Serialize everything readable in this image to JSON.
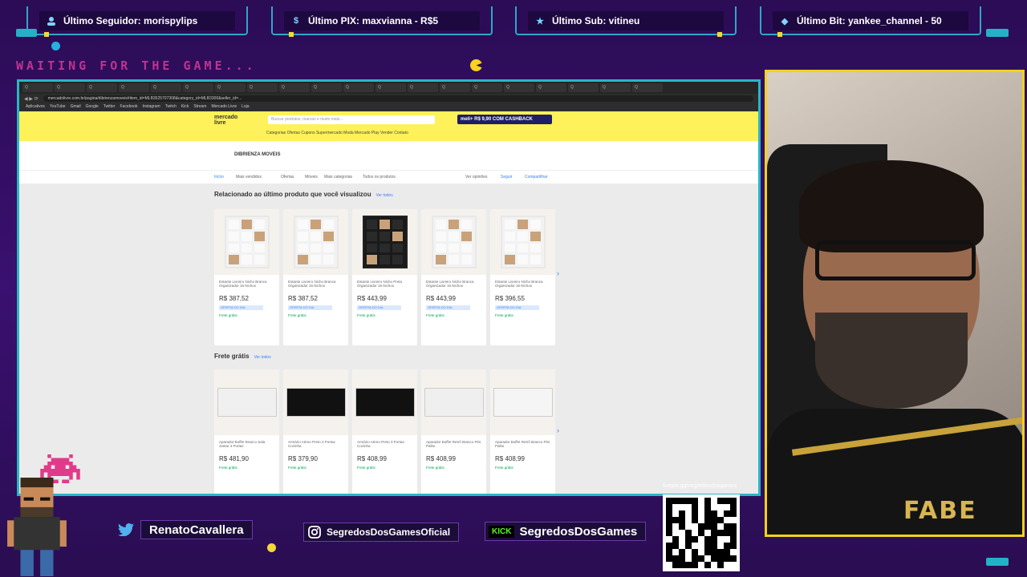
{
  "alerts": [
    {
      "icon": "user-icon",
      "label": "Último Seguidor: morispylips"
    },
    {
      "icon": "dollar-icon",
      "label": "Último PIX: maxvianna - R$5"
    },
    {
      "icon": "star-icon",
      "label": "Último Sub: vitineu"
    },
    {
      "icon": "diamond-icon",
      "label": "Último Bit: yankee_channel - 50"
    }
  ],
  "overlay": {
    "waiting": "WAITING FOR THE GAME...",
    "qr_url": "livepix.gg/segredosdosgames"
  },
  "socials": [
    {
      "icon": "twitter-icon",
      "handle": "RenatoCavallera"
    },
    {
      "icon": "instagram-icon",
      "handle": "SegredosDosGamesOficial"
    },
    {
      "icon": "kick-icon",
      "badge": "KICK",
      "handle": "SegredosDosGames"
    }
  ],
  "browser": {
    "url": "mercadolivre.com.br/pagina/dibrienzamoveis#item_id=MLB3525707308&category_id=MLB3300&seller_id=...",
    "tabs": [
      "Q",
      "Q",
      "Q",
      "Q",
      "Q",
      "Q",
      "Q",
      "Q",
      "Q",
      "Q",
      "Q",
      "Q",
      "Q",
      "Q",
      "Q",
      "Q",
      "Q",
      "Q",
      "Q",
      "Q"
    ],
    "bookmarks": [
      "Aplicativos",
      "YouTube",
      "Gmail",
      "Google",
      "Twitter",
      "Facebook",
      "Instagram",
      "Twitch",
      "Kick",
      "Stream",
      "Mercado Livre",
      "Loja"
    ]
  },
  "ml": {
    "logo_line1": "mercado",
    "logo_line2": "livre",
    "search_placeholder": "Buscar produtos, marcas e muito mais...",
    "promo": "meli+ R$ 9,90 COM CASHBACK",
    "nav": "Categorias   Ofertas   Cupons   Supermercado   Moda   Mercado Play   Vender   Contato",
    "store_name": "DIBRIENZA MOVEIS",
    "subnav": [
      "Início",
      "Mais vendidos",
      "Ofertas",
      "Móveis",
      "Mais categorias",
      "Todos os produtos"
    ],
    "subnav_right": [
      "Ver opiniões",
      "Seguir",
      "Compartilhar"
    ],
    "section1_title": "Relacionado ao último produto que você visualizou",
    "section1_link": "Ver todos",
    "section2_title": "Frete grátis",
    "section2_link": "Ver todos",
    "products1": [
      {
        "title": "Estante Livreiro Nicho Branca Organizador 16 Nichos",
        "price": "R$ 387,52",
        "tag": "OFERTA DO DIA",
        "ship": "Frete grátis",
        "color": "#f2f2f2",
        "frame": "#e8e8e8"
      },
      {
        "title": "Estante Livreiro Nicho Branca Organizador 16 Nichos",
        "price": "R$ 387,52",
        "tag": "OFERTA DO DIA",
        "ship": "Frete grátis",
        "color": "#f2f2f2",
        "frame": "#e8e8e8"
      },
      {
        "title": "Estante Livreiro Nicho Preta Organizador 16 Nichos",
        "price": "R$ 443,99",
        "tag": "OFERTA DO DIA",
        "ship": "Frete grátis",
        "color": "#1a1a1a",
        "frame": "#222"
      },
      {
        "title": "Estante Livreiro Nicho Branca Organizador 16 Nichos",
        "price": "R$ 443,99",
        "tag": "OFERTA DO DIA",
        "ship": "Frete grátis",
        "color": "#f2f2f2",
        "frame": "#e8e8e8"
      },
      {
        "title": "Estante Livreiro Nicho Branca Organizador 16 Nichos",
        "price": "R$ 396,55",
        "tag": "OFERTA DO DIA",
        "ship": "Frete grátis",
        "color": "#f2f2f2",
        "frame": "#e8e8e8"
      }
    ],
    "products2": [
      {
        "title": "Aparador Buffet Branco Sala Jantar 4 Portas",
        "price": "R$ 481,90",
        "ship": "Frete grátis",
        "color": "#f0f0f0"
      },
      {
        "title": "Armário Aéreo Preto 3 Portas Cozinha",
        "price": "R$ 379,90",
        "ship": "Frete grátis",
        "color": "#111"
      },
      {
        "title": "Armário Aéreo Preto 3 Portas Cozinha",
        "price": "R$ 408,99",
        "ship": "Frete grátis",
        "color": "#111"
      },
      {
        "title": "Aparador Buffet Retrô Branco Pés Palito",
        "price": "R$ 408,99",
        "ship": "Frete grátis",
        "color": "#efefef"
      },
      {
        "title": "Aparador Buffet Retrô Branco Pés Palito",
        "price": "R$ 408,99",
        "ship": "Frete grátis",
        "color": "#f5f5f5"
      }
    ]
  },
  "webcam": {
    "shirt_text": "FABE"
  }
}
